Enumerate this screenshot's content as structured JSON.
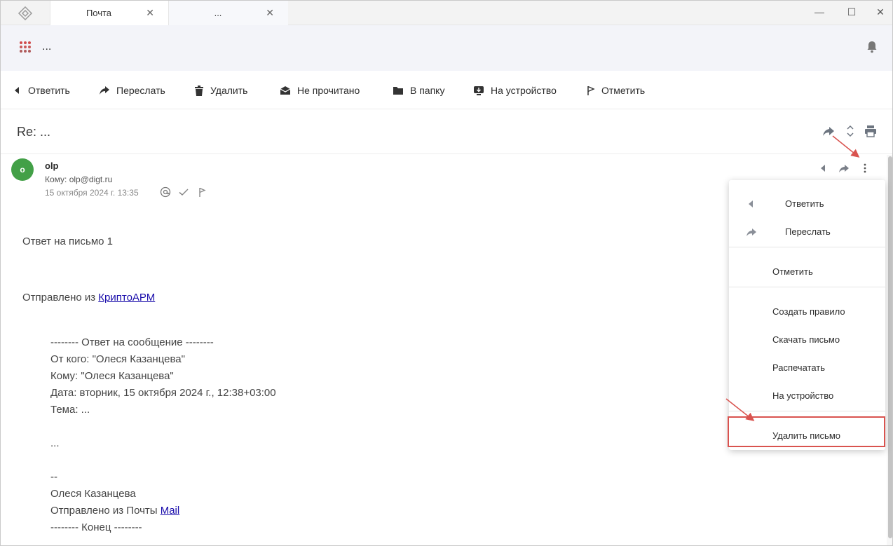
{
  "tabs": [
    {
      "label": "Почта"
    },
    {
      "label": "..."
    }
  ],
  "appbar": {
    "title": "..."
  },
  "toolbar": {
    "reply": "Ответить",
    "forward": "Переслать",
    "delete": "Удалить",
    "unread": "Не прочитано",
    "to_folder": "В папку",
    "to_device": "На устройство",
    "flag": "Отметить"
  },
  "subject": "Re: ...",
  "message": {
    "avatar_letter": "o",
    "sender": "olp",
    "to": "Кому: olp@digt.ru",
    "date": "15 октября 2024 г. 13:35"
  },
  "body": {
    "line1": "Ответ на письмо 1",
    "sent_from_prefix": "Отправлено из ",
    "sent_from_link": "КриптоАРМ",
    "quote_header": "-------- Ответ на сообщение --------",
    "from": "От кого: \"Олеся Казанцева\"",
    "to": "Кому: \"Олеся Казанцева\"",
    "date": "Дата: вторник, 15 октября 2024 г., 12:38+03:00",
    "topic": "Тема: ...",
    "dots": "...",
    "sig_dash": "--",
    "sig_name": "Олеся Казанцева",
    "sig_sent_prefix": "Отправлено из Почты ",
    "sig_sent_link": "Mail",
    "quote_footer": "-------- Конец --------"
  },
  "menu": {
    "reply": "Ответить",
    "forward": "Переслать",
    "flag": "Отметить",
    "create_rule": "Создать правило",
    "download": "Скачать письмо",
    "print": "Распечатать",
    "to_device": "На устройство",
    "delete": "Удалить письмо"
  },
  "colors": {
    "avatar": "#43a047",
    "highlight": "#d9534f",
    "link": "#1a0dab"
  }
}
